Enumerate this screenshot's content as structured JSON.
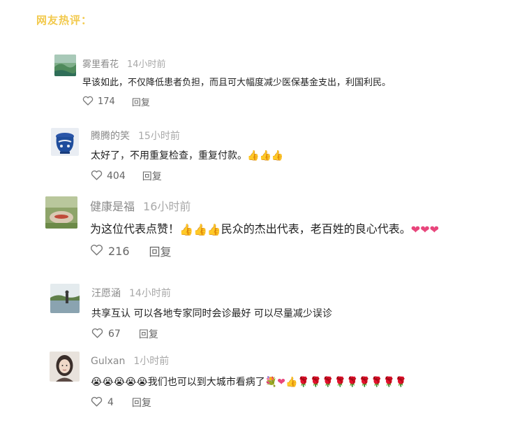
{
  "section_title": "网友热评：",
  "reply_label": "回复",
  "comments": [
    {
      "user": "雾里看花",
      "time": "14小时前",
      "text": "早该如此，不仅降低患者负担，而且可大幅度减少医保基金支出，利国利民。",
      "emojis": [],
      "likes": "174",
      "avatar_icon": "landscape-avatar-icon"
    },
    {
      "user": "腾腾的笑",
      "time": "15小时前",
      "text": "太好了，不用重复检查，重复付款。",
      "emojis": [
        "thumbs-up",
        "thumbs-up",
        "thumbs-up"
      ],
      "likes": "404",
      "avatar_icon": "porcelain-avatar-icon"
    },
    {
      "user": "健康是福",
      "time": "16小时前",
      "text_a": "为这位代表点赞！",
      "emojis_a": [
        "thumbs-up",
        "thumbs-up",
        "thumbs-up"
      ],
      "text_b": "民众的杰出代表，老百姓的良心代表。",
      "emojis_b": [
        "heart",
        "heart",
        "heart"
      ],
      "likes": "216",
      "avatar_icon": "rock-avatar-icon"
    },
    {
      "user": "汪愿涵",
      "time": "14小时前",
      "text": "共享互认 可以各地专家同时会诊最好 可以尽量减少误诊",
      "emojis": [],
      "likes": "67",
      "avatar_icon": "lakeside-avatar-icon"
    },
    {
      "user": "Gulxan",
      "time": "1小时前",
      "text": "我们也可以到大城市看病了",
      "emojis_before": [
        "crying-face",
        "crying-face",
        "crying-face",
        "crying-face",
        "crying-face"
      ],
      "emojis_after": [
        "bouquet",
        "heart",
        "thumbs-up",
        "rose",
        "rose",
        "rose",
        "rose",
        "rose",
        "rose",
        "rose",
        "rose",
        "rose"
      ],
      "likes": "4",
      "avatar_icon": "portrait-avatar-icon"
    }
  ]
}
